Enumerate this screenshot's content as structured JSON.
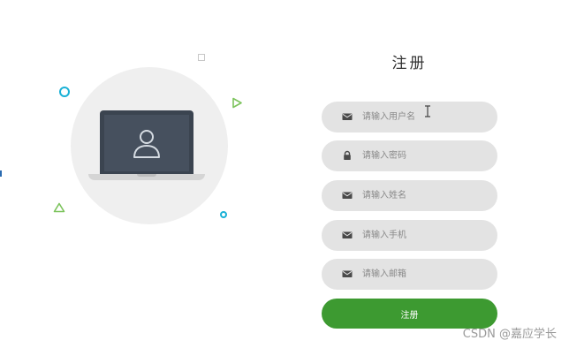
{
  "form": {
    "title": "注册",
    "fields": [
      {
        "icon": "envelope-icon",
        "placeholder": "请输入用户名",
        "value": ""
      },
      {
        "icon": "lock-icon",
        "placeholder": "请输入密码",
        "value": ""
      },
      {
        "icon": "envelope-icon",
        "placeholder": "请输入姓名",
        "value": ""
      },
      {
        "icon": "envelope-icon",
        "placeholder": "请输入手机",
        "value": ""
      },
      {
        "icon": "envelope-icon",
        "placeholder": "请输入邮箱",
        "value": ""
      }
    ],
    "submit_label": "注册"
  },
  "illustration": {
    "icon": "laptop-user-icon"
  },
  "watermark": "CSDN @嘉应学长",
  "colors": {
    "accent_green": "#3d9a31",
    "field_bg": "#e3e3e3",
    "deco_blue": "#1ab1d6",
    "deco_green": "#7cc35c"
  }
}
